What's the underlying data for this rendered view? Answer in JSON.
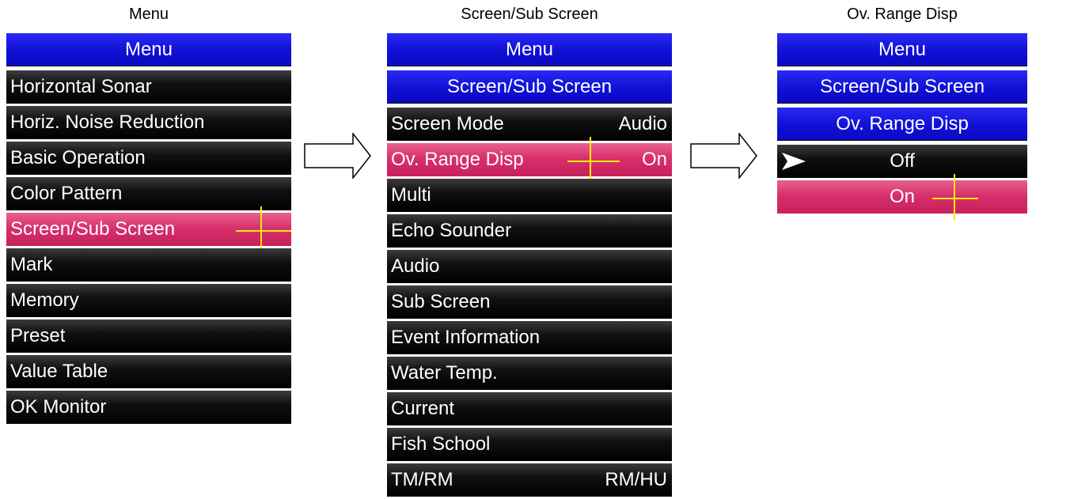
{
  "panels": [
    {
      "caption": "Menu",
      "header": "Menu",
      "items": [
        {
          "label": "Horizontal Sonar"
        },
        {
          "label": "Horiz. Noise Reduction"
        },
        {
          "label": "Basic Operation"
        },
        {
          "label": "Color Pattern"
        },
        {
          "label": "Screen/Sub Screen",
          "selected": true
        },
        {
          "label": "Mark"
        },
        {
          "label": "Memory"
        },
        {
          "label": "Preset"
        },
        {
          "label": "Value Table"
        },
        {
          "label": "OK Monitor"
        }
      ]
    },
    {
      "caption": "Screen/Sub Screen",
      "headers": [
        "Menu",
        "Screen/Sub Screen"
      ],
      "items": [
        {
          "label": "Screen Mode",
          "value": "Audio"
        },
        {
          "label": "Ov. Range Disp",
          "value": "On",
          "selected": true
        },
        {
          "label": "Multi"
        },
        {
          "label": "Echo Sounder"
        },
        {
          "label": "Audio"
        },
        {
          "label": "Sub Screen"
        },
        {
          "label": "Event Information"
        },
        {
          "label": "Water Temp."
        },
        {
          "label": "Current"
        },
        {
          "label": "Fish School"
        },
        {
          "label": "TM/RM",
          "value": "RM/HU"
        }
      ]
    },
    {
      "caption": "Ov. Range Disp",
      "headers": [
        "Menu",
        "Screen/Sub Screen",
        "Ov. Range Disp"
      ],
      "options": [
        {
          "label": "Off",
          "checked": true
        },
        {
          "label": "On",
          "selected": true
        }
      ]
    }
  ],
  "colors": {
    "header_blue": "#1010d6",
    "item_black": "#000000",
    "selected_pink": "#d8306c",
    "cursor_yellow": "#ffec00"
  },
  "icons": [
    "arrow-right-icon",
    "checkmark-pointer-icon",
    "crosshair-cursor-icon"
  ]
}
